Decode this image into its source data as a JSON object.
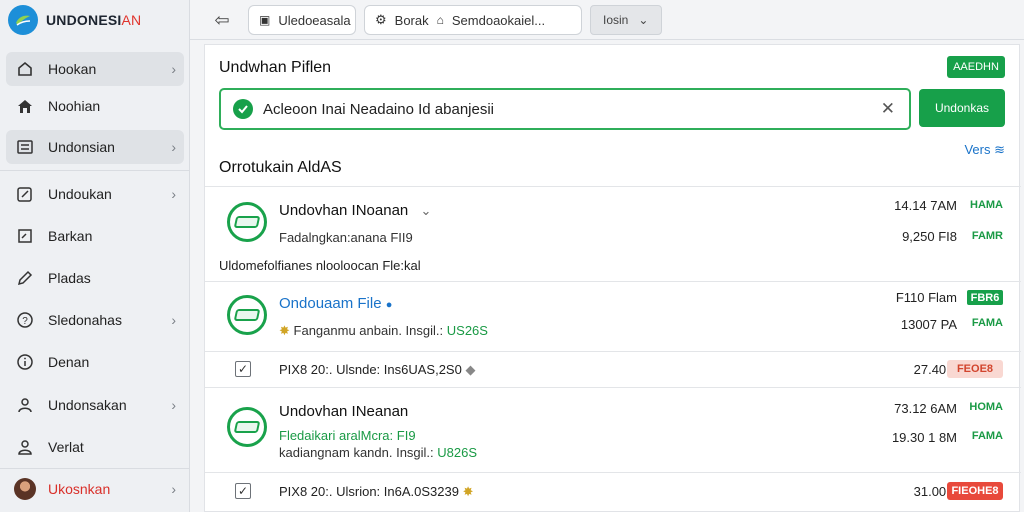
{
  "brand": {
    "name": "UNDONESI",
    "accent": "AN"
  },
  "sidebar": {
    "items": [
      {
        "label": "Hookan",
        "icon": "home-outline-icon",
        "chevron": true,
        "active": true
      },
      {
        "label": "Noohian",
        "icon": "home-filled-icon",
        "chevron": false
      },
      {
        "label": "Undonsian",
        "icon": "list-icon",
        "chevron": true,
        "active": true
      },
      {
        "label": "Undoukan",
        "icon": "edit-box-icon",
        "chevron": true
      },
      {
        "label": "Barkan",
        "icon": "edit-square-icon",
        "chevron": false
      },
      {
        "label": "Pladas",
        "icon": "pen-icon",
        "chevron": false
      },
      {
        "label": "Sledonahas",
        "icon": "question-icon",
        "chevron": true
      },
      {
        "label": "Denan",
        "icon": "info-icon",
        "chevron": false
      },
      {
        "label": "Undonsakan",
        "icon": "user-group-icon",
        "chevron": true
      },
      {
        "label": "Verlat",
        "icon": "user-icon",
        "chevron": false
      },
      {
        "label": "Ukosnkan",
        "icon": "avatar",
        "chevron": true,
        "red": true
      }
    ]
  },
  "topbar": {
    "field1": "Uledoeasala",
    "field2_prefix": "Borak",
    "field2": "Semdoaokaiel...",
    "select": "Iosin"
  },
  "main": {
    "title": "Undwhan Piflen",
    "badge": "AAEDHN",
    "alert_text": "Acleoon Inai Neadaino Id abanjesii",
    "alert_button": "Undonkas",
    "section_title": "Orrotukain AldAS",
    "view_link": "Vers ≋",
    "rows": [
      {
        "title": "Undovhan INoanan",
        "sub": "Fadalngkan:anana FII9",
        "meta1": "14.14 7AM",
        "tag1": "HAMA",
        "meta2": "9,250 FI8",
        "tag2": "FAMR"
      },
      {
        "title": "Ondouaam File",
        "sub_prefix": "Fanganmu anbain. Insgil.:",
        "sub_value": "US26S",
        "meta1": "F110 Flam",
        "tag1": "FBR6",
        "meta2": "13007 PA",
        "tag2": "FAMA"
      },
      {
        "title": "Undovhan INeanan",
        "sub_green": "Fledaikari aralMcra:",
        "sub_green_value": "FI9",
        "sub": "kadiangnam kandn. Insgil.:",
        "sub_value": "U826S",
        "meta1": "73.12 6AM",
        "tag1": "HOMA",
        "meta2": "19.30 1 8M",
        "tag2": "FAMA"
      }
    ],
    "desc_line": "Uldomefolfianes nlooloocan Fle:kal",
    "check_rows": [
      {
        "text": "PIX8 20:. Ulsnde: Ins6UAS,2S0",
        "meta": "27.40M",
        "tag": "FEOE8"
      },
      {
        "text": "PIX8 20:. Ulsrion: In6A.0S3239",
        "meta": "31.00M",
        "tag": "FIEOHE8"
      }
    ]
  },
  "colors": {
    "accent_green": "#17a04a",
    "link_blue": "#1a73c9",
    "alert_red": "#e8493b",
    "brand_blue": "#1d8fd8"
  }
}
